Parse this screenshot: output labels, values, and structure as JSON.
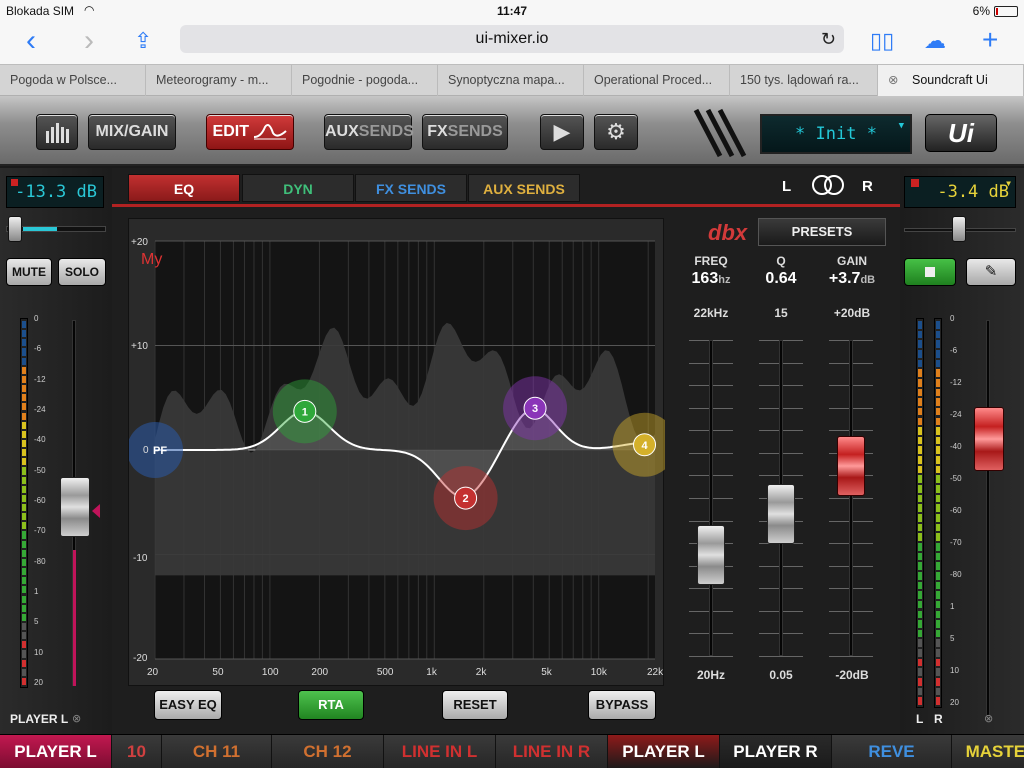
{
  "status": {
    "carrier": "Blokada SIM",
    "time": "11:47",
    "battery": "6%"
  },
  "browser": {
    "url": "ui-mixer.io",
    "back_icon": "chevron-left-icon",
    "forward_icon": "chevron-right-icon"
  },
  "tabs": [
    {
      "label": "Pogoda w Polsce..."
    },
    {
      "label": "Meteorogramy - m..."
    },
    {
      "label": "Pogodnie - pogoda..."
    },
    {
      "label": "Synoptyczna mapa..."
    },
    {
      "label": "Operational Proced..."
    },
    {
      "label": "150 tys. lądowań ra..."
    },
    {
      "label": "Soundcraft Ui",
      "active": true
    }
  ],
  "toolbar": {
    "mixgain": "MIX/GAIN",
    "edit": "EDIT",
    "aux_a": "AUX",
    "aux_b": "SENDS",
    "fx_a": "FX",
    "fx_b": "SENDS",
    "snapshot": "* Init *",
    "logo": "Ui"
  },
  "left_channel": {
    "gain": "-13.3 dB",
    "mute": "MUTE",
    "solo": "SOLO",
    "name": "PLAYER L",
    "fader_level": 0.49,
    "meter_scale": [
      "0",
      "-6",
      "-12",
      "-24",
      "-40",
      "-50",
      "-60",
      "-70",
      "-80",
      "1",
      "5",
      "10",
      "20"
    ]
  },
  "right_channel": {
    "gain": "-3.4 dB",
    "name_l": "L",
    "name_r": "R",
    "fader_level": 0.7,
    "meter_scale": [
      "0",
      "-6",
      "-12",
      "-24",
      "-40",
      "-50",
      "-60",
      "-70",
      "-80",
      "1",
      "5",
      "10",
      "20"
    ]
  },
  "subtabs": {
    "eq": "EQ",
    "dyn": "DYN",
    "fx": "FX SENDS",
    "aux": "AUX SENDS",
    "l": "L",
    "r": "R"
  },
  "eq": {
    "preset_label": "My",
    "y_labels": [
      "+20",
      "+10",
      "0",
      "-10",
      "-20"
    ],
    "x_labels": [
      "20",
      "50",
      "100",
      "200",
      "500",
      "1k",
      "2k",
      "5k",
      "10k",
      "22k"
    ],
    "bands": [
      {
        "id": "1",
        "color": "#2fa83a"
      },
      {
        "id": "2",
        "color": "#c43030"
      },
      {
        "id": "3",
        "color": "#8a35b8"
      },
      {
        "id": "4",
        "color": "#d4b02a"
      }
    ],
    "hpf_label": "PF",
    "buttons": {
      "easy": "EASY EQ",
      "rta": "RTA",
      "reset": "RESET",
      "bypass": "BYPASS"
    }
  },
  "dbx": {
    "logo": "dbx",
    "presets": "PRESETS",
    "freq": {
      "title": "FREQ",
      "value": "163",
      "unit": "hz",
      "max": "22kHz",
      "min": "20Hz",
      "level": 0.32
    },
    "q": {
      "title": "Q",
      "value": "0.64",
      "max": "15",
      "min": "0.05",
      "level": 0.45
    },
    "gain": {
      "title": "GAIN",
      "value": "+3.7",
      "unit": "dB",
      "max": "+20dB",
      "min": "-20dB",
      "level": 0.6
    }
  },
  "channel_bar": [
    "10",
    "CH 11",
    "CH 12",
    "LINE IN L",
    "LINE IN R",
    "PLAYER L",
    "PLAYER R",
    "REVE",
    "MASTER"
  ],
  "active_channel": "PLAYER L"
}
